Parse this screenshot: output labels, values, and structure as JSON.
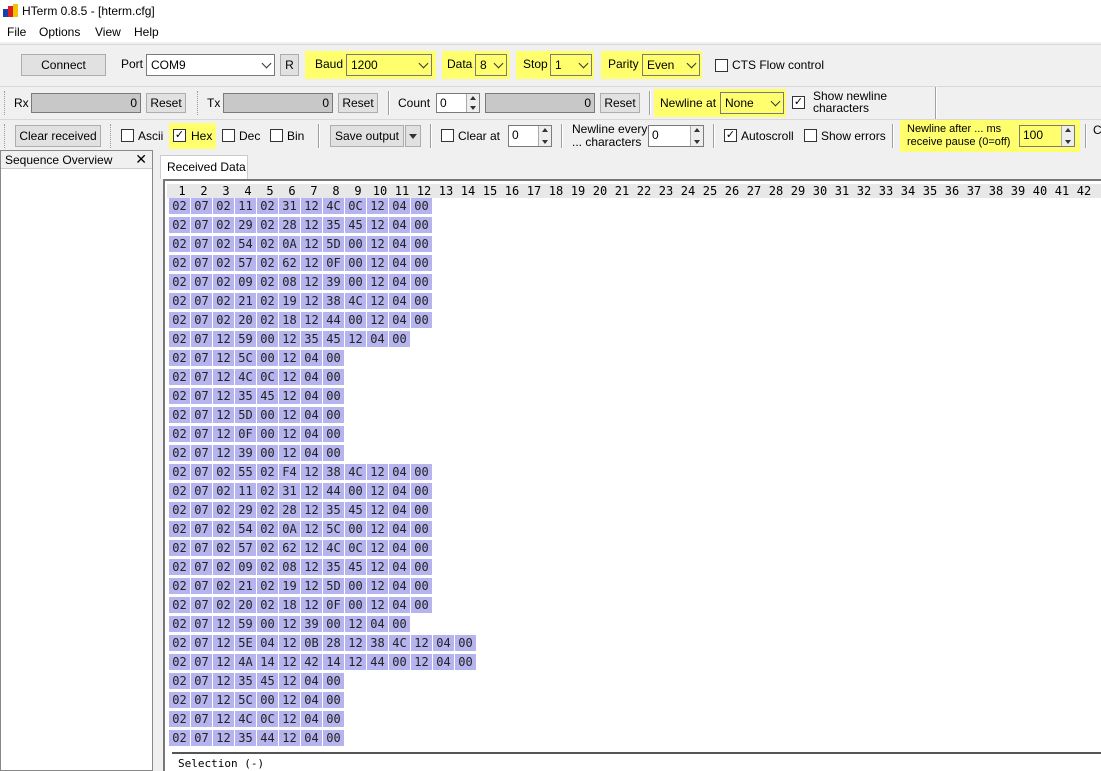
{
  "window": {
    "title": "HTerm 0.8.5 - [hterm.cfg]"
  },
  "menu": {
    "file": "File",
    "options": "Options",
    "view": "View",
    "help": "Help"
  },
  "connection": {
    "connect_label": "Connect",
    "port_label": "Port",
    "port_value": "COM9",
    "refresh_label": "R",
    "baud_label": "Baud",
    "baud_value": "1200",
    "data_label": "Data",
    "data_value": "8",
    "stop_label": "Stop",
    "stop_value": "1",
    "parity_label": "Parity",
    "parity_value": "Even",
    "cts_label": "CTS Flow control",
    "cts_checked": false
  },
  "counters": {
    "rx_label": "Rx",
    "rx_value": "0",
    "rx_reset": "Reset",
    "tx_label": "Tx",
    "tx_value": "0",
    "tx_reset": "Reset",
    "count_label": "Count",
    "count_value": "0",
    "count_field_value": "0",
    "count_reset": "Reset",
    "newline_at_label": "Newline at",
    "newline_at_value": "None",
    "show_newline_label_1": "Show newline",
    "show_newline_label_2": "characters",
    "show_newline_checked": true
  },
  "display": {
    "clear_received_label": "Clear received",
    "ascii_label": "Ascii",
    "ascii_checked": false,
    "hex_label": "Hex",
    "hex_checked": true,
    "dec_label": "Dec",
    "dec_checked": false,
    "bin_label": "Bin",
    "bin_checked": false,
    "save_output_label": "Save output",
    "clear_at_label": "Clear at",
    "clear_at_value": "0",
    "newline_every_label_1": "Newline every",
    "newline_every_label_2": "... characters",
    "newline_every_value": "0",
    "autoscroll_label": "Autoscroll",
    "autoscroll_checked": true,
    "show_errors_label": "Show errors",
    "show_errors_checked": false,
    "newline_after_label_1": "Newline after ... ms",
    "newline_after_label_2": "receive pause (0=off)",
    "newline_after_value": "100",
    "truncated_label": "C"
  },
  "sequence_panel": {
    "title": "Sequence Overview",
    "close": "✕"
  },
  "received": {
    "tab_label": "Received Data",
    "column_numbers": [
      "1",
      "2",
      "3",
      "4",
      "5",
      "6",
      "7",
      "8",
      "9",
      "10",
      "11",
      "12",
      "13",
      "14",
      "15",
      "16",
      "17",
      "18",
      "19",
      "20",
      "21",
      "22",
      "23",
      "24",
      "25",
      "26",
      "27",
      "28",
      "29",
      "30",
      "31",
      "32",
      "33",
      "34",
      "35",
      "36",
      "37",
      "38",
      "39",
      "40",
      "41",
      "42"
    ],
    "rows": [
      [
        "02",
        "07",
        "02",
        "11",
        "02",
        "31",
        "12",
        "4C",
        "0C",
        "12",
        "04",
        "00"
      ],
      [
        "02",
        "07",
        "02",
        "29",
        "02",
        "28",
        "12",
        "35",
        "45",
        "12",
        "04",
        "00"
      ],
      [
        "02",
        "07",
        "02",
        "54",
        "02",
        "0A",
        "12",
        "5D",
        "00",
        "12",
        "04",
        "00"
      ],
      [
        "02",
        "07",
        "02",
        "57",
        "02",
        "62",
        "12",
        "0F",
        "00",
        "12",
        "04",
        "00"
      ],
      [
        "02",
        "07",
        "02",
        "09",
        "02",
        "08",
        "12",
        "39",
        "00",
        "12",
        "04",
        "00"
      ],
      [
        "02",
        "07",
        "02",
        "21",
        "02",
        "19",
        "12",
        "38",
        "4C",
        "12",
        "04",
        "00"
      ],
      [
        "02",
        "07",
        "02",
        "20",
        "02",
        "18",
        "12",
        "44",
        "00",
        "12",
        "04",
        "00"
      ],
      [
        "02",
        "07",
        "12",
        "59",
        "00",
        "12",
        "35",
        "45",
        "12",
        "04",
        "00"
      ],
      [
        "02",
        "07",
        "12",
        "5C",
        "00",
        "12",
        "04",
        "00"
      ],
      [
        "02",
        "07",
        "12",
        "4C",
        "0C",
        "12",
        "04",
        "00"
      ],
      [
        "02",
        "07",
        "12",
        "35",
        "45",
        "12",
        "04",
        "00"
      ],
      [
        "02",
        "07",
        "12",
        "5D",
        "00",
        "12",
        "04",
        "00"
      ],
      [
        "02",
        "07",
        "12",
        "0F",
        "00",
        "12",
        "04",
        "00"
      ],
      [
        "02",
        "07",
        "12",
        "39",
        "00",
        "12",
        "04",
        "00"
      ],
      [
        "02",
        "07",
        "02",
        "55",
        "02",
        "F4",
        "12",
        "38",
        "4C",
        "12",
        "04",
        "00"
      ],
      [
        "02",
        "07",
        "02",
        "11",
        "02",
        "31",
        "12",
        "44",
        "00",
        "12",
        "04",
        "00"
      ],
      [
        "02",
        "07",
        "02",
        "29",
        "02",
        "28",
        "12",
        "35",
        "45",
        "12",
        "04",
        "00"
      ],
      [
        "02",
        "07",
        "02",
        "54",
        "02",
        "0A",
        "12",
        "5C",
        "00",
        "12",
        "04",
        "00"
      ],
      [
        "02",
        "07",
        "02",
        "57",
        "02",
        "62",
        "12",
        "4C",
        "0C",
        "12",
        "04",
        "00"
      ],
      [
        "02",
        "07",
        "02",
        "09",
        "02",
        "08",
        "12",
        "35",
        "45",
        "12",
        "04",
        "00"
      ],
      [
        "02",
        "07",
        "02",
        "21",
        "02",
        "19",
        "12",
        "5D",
        "00",
        "12",
        "04",
        "00"
      ],
      [
        "02",
        "07",
        "02",
        "20",
        "02",
        "18",
        "12",
        "0F",
        "00",
        "12",
        "04",
        "00"
      ],
      [
        "02",
        "07",
        "12",
        "59",
        "00",
        "12",
        "39",
        "00",
        "12",
        "04",
        "00"
      ],
      [
        "02",
        "07",
        "12",
        "5E",
        "04",
        "12",
        "0B",
        "28",
        "12",
        "38",
        "4C",
        "12",
        "04",
        "00"
      ],
      [
        "02",
        "07",
        "12",
        "4A",
        "14",
        "12",
        "42",
        "14",
        "12",
        "44",
        "00",
        "12",
        "04",
        "00"
      ],
      [
        "02",
        "07",
        "12",
        "35",
        "45",
        "12",
        "04",
        "00"
      ],
      [
        "02",
        "07",
        "12",
        "5C",
        "00",
        "12",
        "04",
        "00"
      ],
      [
        "02",
        "07",
        "12",
        "4C",
        "0C",
        "12",
        "04",
        "00"
      ],
      [
        "02",
        "07",
        "12",
        "35",
        "44",
        "12",
        "04",
        "00"
      ]
    ],
    "selection_label": "Selection (-)"
  },
  "colors": {
    "highlight": "#ffff6e",
    "byte_bg": "#b6b4ee"
  }
}
